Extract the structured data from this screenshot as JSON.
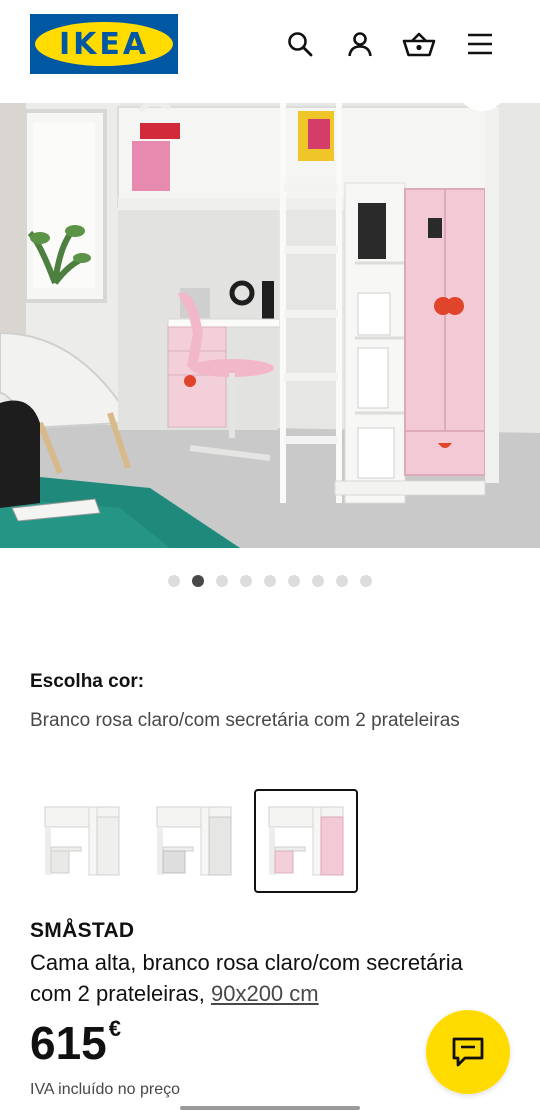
{
  "header": {
    "logo_text": "IKEA",
    "icons": [
      "search-icon",
      "user-icon",
      "basket-icon",
      "menu-icon"
    ],
    "colors": {
      "logo_blue": "#0058a3",
      "logo_yellow": "#ffdb00"
    }
  },
  "gallery": {
    "image_count": 9,
    "active_index": 1
  },
  "color_choice": {
    "label": "Escolha cor:",
    "value": "Branco rosa claro/com secretária com 2 prateleiras",
    "variants": [
      {
        "name": "white-grey",
        "selected": false
      },
      {
        "name": "white-grey-drawers",
        "selected": false
      },
      {
        "name": "white-light-pink",
        "selected": true
      }
    ]
  },
  "product": {
    "name": "SMÅSTAD",
    "description": "Cama alta, branco rosa claro/com secretária com 2 prateleiras,",
    "size": "90x200 cm",
    "price": "615",
    "currency": "€",
    "vat_note": "IVA incluído no preço"
  },
  "chat": {
    "icon": "chat-icon",
    "color": "#ffdb00"
  }
}
